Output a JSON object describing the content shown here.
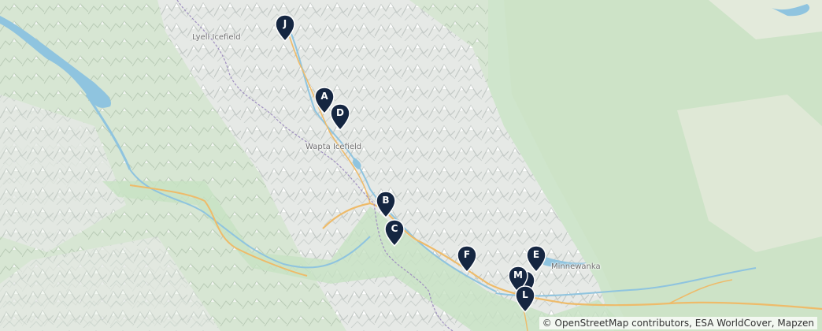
{
  "map": {
    "place_labels": [
      {
        "id": "lyell-icefield",
        "text": "Lyell Icefield"
      },
      {
        "id": "wapta-icefield",
        "text": "Wapta Icefield"
      },
      {
        "id": "lake-minnewanka",
        "text": "Minnewanka"
      }
    ],
    "markers": [
      {
        "id": "J",
        "label": "J"
      },
      {
        "id": "A",
        "label": "A"
      },
      {
        "id": "D",
        "label": "D"
      },
      {
        "id": "B",
        "label": "B"
      },
      {
        "id": "C",
        "label": "C"
      },
      {
        "id": "F",
        "label": "F"
      },
      {
        "id": "E",
        "label": "E"
      },
      {
        "id": "K",
        "label": ""
      },
      {
        "id": "M",
        "label": "M"
      },
      {
        "id": "L",
        "label": "L"
      }
    ],
    "marker_color": "#152641",
    "attribution": "© OpenStreetMap contributors, ESA WorldCover, Mapzen"
  }
}
